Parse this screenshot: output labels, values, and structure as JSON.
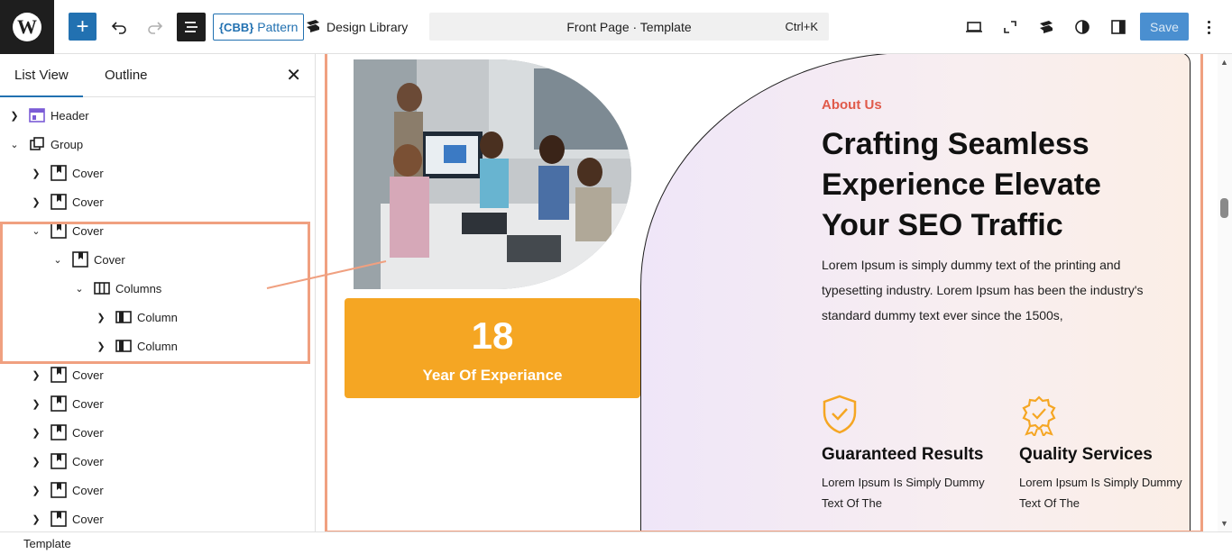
{
  "toolbar": {
    "pattern_badge": "{CBB}",
    "pattern_label": "Pattern",
    "design_library_label": "Design Library",
    "command_title": "Front Page · Template",
    "command_shortcut": "Ctrl+K",
    "save_label": "Save"
  },
  "sidebar": {
    "tabs": [
      {
        "label": "List View",
        "active": true
      },
      {
        "label": "Outline",
        "active": false
      }
    ],
    "tree": [
      {
        "label": "Header",
        "expanded": false,
        "icon": "template-part-icon"
      },
      {
        "label": "Group",
        "expanded": true,
        "icon": "group-icon"
      },
      {
        "label": "Cover",
        "expanded": false,
        "icon": "cover-icon"
      },
      {
        "label": "Cover",
        "expanded": false,
        "icon": "cover-icon"
      },
      {
        "label": "Cover",
        "expanded": true,
        "icon": "cover-icon"
      },
      {
        "label": "Cover",
        "expanded": true,
        "icon": "cover-icon"
      },
      {
        "label": "Columns",
        "expanded": true,
        "icon": "columns-icon"
      },
      {
        "label": "Column",
        "expanded": false,
        "icon": "column-icon"
      },
      {
        "label": "Column",
        "expanded": false,
        "icon": "column-icon"
      },
      {
        "label": "Cover",
        "expanded": false,
        "icon": "cover-icon"
      },
      {
        "label": "Cover",
        "expanded": false,
        "icon": "cover-icon"
      },
      {
        "label": "Cover",
        "expanded": false,
        "icon": "cover-icon"
      },
      {
        "label": "Cover",
        "expanded": false,
        "icon": "cover-icon"
      },
      {
        "label": "Cover",
        "expanded": false,
        "icon": "cover-icon"
      },
      {
        "label": "Cover",
        "expanded": false,
        "icon": "cover-icon"
      }
    ]
  },
  "status_bar": {
    "label": "Template"
  },
  "canvas": {
    "stat": {
      "number": "18",
      "label": "Year Of Experiance"
    },
    "about": {
      "eyebrow": "About Us",
      "title": "Crafting Seamless Experience Elevate Your SEO Traffic",
      "description": "Lorem Ipsum is simply dummy text of the printing and typesetting industry. Lorem Ipsum has been the industry's standard dummy text ever since the 1500s,"
    },
    "features": [
      {
        "title": "Guaranteed Results",
        "description": "Lorem Ipsum Is Simply Dummy Text Of The",
        "icon": "shield-check-icon"
      },
      {
        "title": "Quality Services",
        "description": "Lorem Ipsum Is Simply Dummy Text Of The",
        "icon": "award-badge-icon"
      }
    ]
  },
  "colors": {
    "accent": "#2271b1",
    "highlight": "#f0a080",
    "stat_card": "#f5a623",
    "eyebrow": "#e05a4a"
  }
}
